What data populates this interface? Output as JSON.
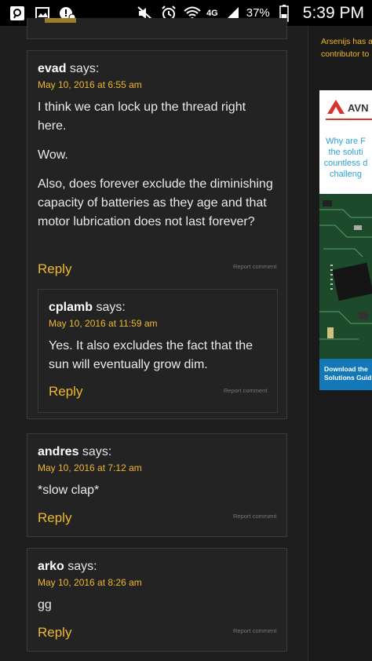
{
  "status_bar": {
    "battery_percent": "37%",
    "time": "5:39 PM",
    "network": "4G",
    "icons": [
      "search-icon",
      "image-icon",
      "alert-icon",
      "mute-icon",
      "alarm-icon",
      "wifi-icon",
      "signal-icon",
      "battery-icon"
    ]
  },
  "comments": [
    {
      "author": "evad",
      "says": "says:",
      "date": "May 10, 2016 at 6:55 am",
      "paragraphs": [
        "I think we can lock up the thread right here.",
        "Wow.",
        "Also, does forever exclude the diminishing capacity of batteries as they age and that motor lubrication does not last forever?"
      ],
      "reply": "Reply",
      "report": "Report comment"
    },
    {
      "author": "cplamb",
      "says": "says:",
      "date": "May 10, 2016 at 11:59 am",
      "paragraphs": [
        "Yes. It also excludes the fact that the sun will eventually grow dim."
      ],
      "reply": "Reply",
      "report": "Report comment"
    },
    {
      "author": "andres",
      "says": "says:",
      "date": "May 10, 2016 at 7:12 am",
      "paragraphs": [
        "*slow clap*"
      ],
      "reply": "Reply",
      "report": "Report comment"
    },
    {
      "author": "arko",
      "says": "says:",
      "date": "May 10, 2016 at 8:26 am",
      "paragraphs": [
        "gg"
      ],
      "reply": "Reply",
      "report": "Report comment"
    }
  ],
  "sidebar": {
    "line1": "Arsenijs has a",
    "line2": "contributor to",
    "ad": {
      "brand": "AVN",
      "headline_lines": [
        "Why are F",
        "the soluti",
        "countless d",
        "challeng"
      ],
      "cta_lines": [
        "Download the",
        "Solutions Guid"
      ]
    }
  },
  "colors": {
    "accent": "#f0b92c",
    "background": "#1e1e1e",
    "card": "#232323",
    "border": "#3a3a3a"
  }
}
